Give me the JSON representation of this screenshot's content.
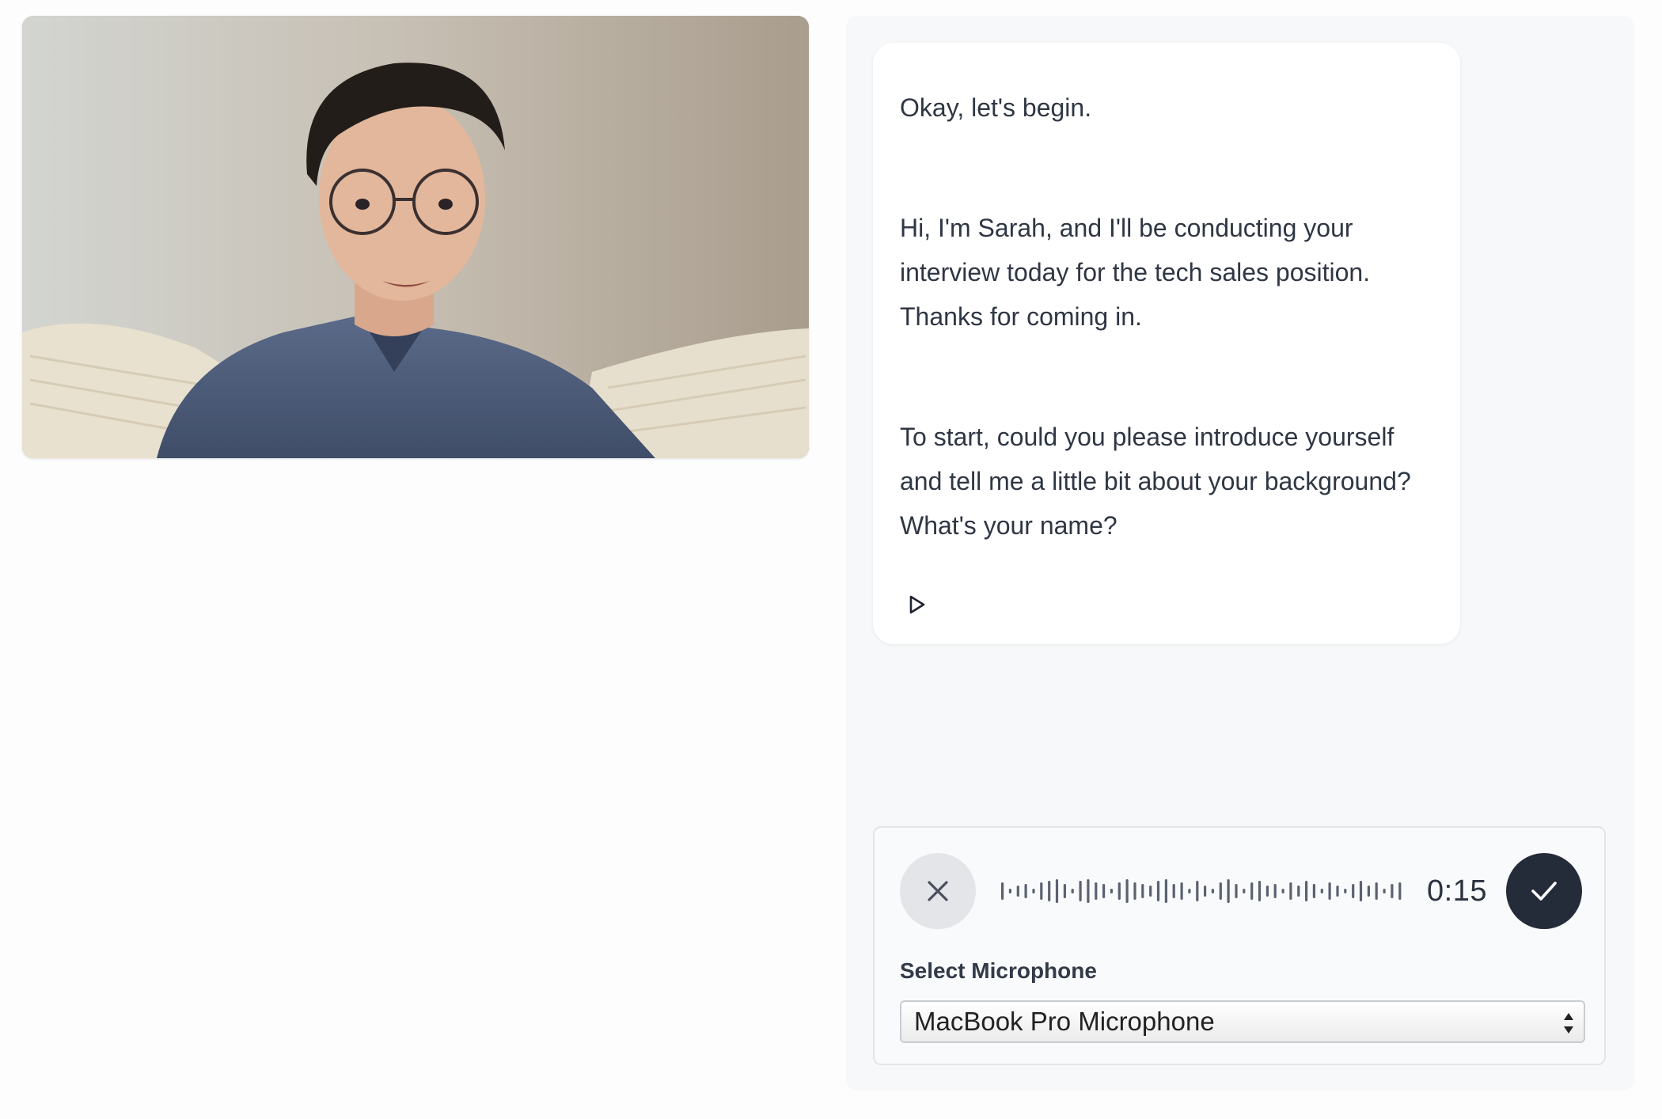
{
  "video": {
    "icon": "interviewer-video-feed"
  },
  "message": {
    "paragraphs": [
      "Okay, let's begin.",
      "Hi, I'm Sarah, and I'll be conducting your interview today for the tech sales position. Thanks for coming in.",
      "To start, could you please introduce yourself and tell me a little bit about your background? What's your name?"
    ],
    "play_icon": "play-icon"
  },
  "recorder": {
    "cancel_icon": "close-icon",
    "waveform_icon": "audio-waveform",
    "timer": "0:15",
    "confirm_icon": "checkmark-icon",
    "microphone_label": "Select Microphone",
    "microphone_selected": "MacBook Pro Microphone"
  },
  "colors": {
    "confirm_button": "#242c3a",
    "cancel_button": "#e4e5e8",
    "panel_background": "#f7f8f9"
  }
}
